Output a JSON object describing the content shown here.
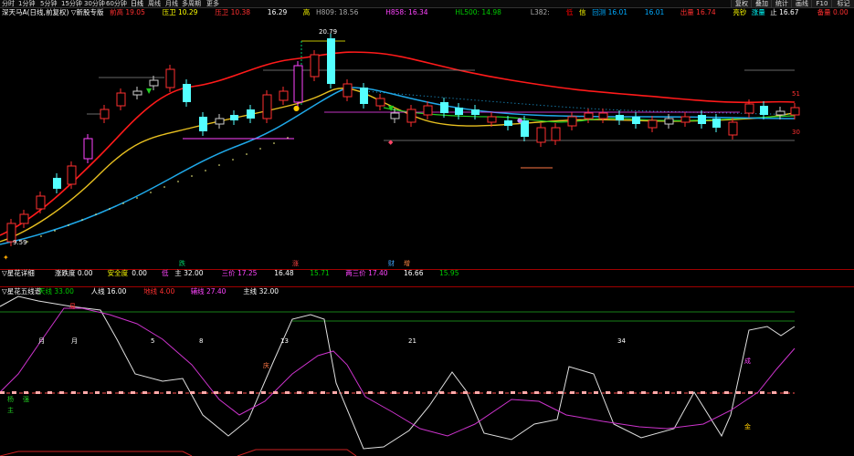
{
  "toolbar": {
    "tabs": [
      "分时",
      "1分钟",
      "5分钟",
      "15分钟",
      "30分钟",
      "60分钟",
      "日线",
      "周线",
      "月线",
      "多周期",
      "更多"
    ],
    "right_buttons": [
      "复权",
      "叠加",
      "统计",
      "画线",
      "F10",
      "标记"
    ]
  },
  "main_info": {
    "title": "深天马A(日线,前复权) ▽新股专版",
    "items": [
      {
        "label": "前高",
        "value": "19.05",
        "color": "#ff3030"
      },
      {
        "label": "压卫",
        "value": "10.29",
        "color": "#ffff00"
      },
      {
        "label": "压卫",
        "value": "10.38",
        "color": "#ff3030"
      },
      {
        "label": "",
        "value": "16.29",
        "color": "#ffffff"
      },
      {
        "label": "高",
        "value": "",
        "color": "#ffff00"
      },
      {
        "label": "H809:",
        "value": "18.56",
        "color": "#aaaaaa"
      },
      {
        "label": "H858:",
        "value": "16.34",
        "color": "#ff44ff"
      },
      {
        "label": "HL500:",
        "value": "14.98",
        "color": "#00cc00"
      },
      {
        "label": "L382:",
        "value": "",
        "color": "#aaaaaa"
      },
      {
        "label": "低",
        "value": "",
        "color": "#ff0000"
      },
      {
        "label": "信",
        "value": "",
        "color": "#ffff00"
      },
      {
        "label": "回测",
        "value": "16.01",
        "color": "#00aaff"
      },
      {
        "label": "",
        "value": "16.01",
        "color": "#00aaff"
      },
      {
        "label": "出量",
        "value": "16.74",
        "color": "#ff3030"
      },
      {
        "label": "亮钞",
        "value": "",
        "color": "#ffff00"
      },
      {
        "label": "涨量",
        "value": "",
        "color": "#00ffff"
      },
      {
        "label": "止",
        "value": "16.67",
        "color": "#ffffff"
      },
      {
        "label": "备量",
        "value": "0.00",
        "color": "#ff3030"
      }
    ],
    "price_labels": {
      "high": "20.79",
      "low": "9.59",
      "right_top": "51",
      "right_bottom": "30"
    },
    "signals": [
      "跌",
      "涨",
      "财",
      "增"
    ]
  },
  "panel2_info": {
    "title": "▽星花详细",
    "items": [
      {
        "text": "涨跌度 0.00",
        "color": "#ffffff"
      },
      {
        "text": "安全度",
        "color": "#ffff00"
      },
      {
        "text": "0.00",
        "color": "#ffffff"
      },
      {
        "text": "低",
        "color": "#ff44ff"
      },
      {
        "text": "主 32.00",
        "color": "#ffffff"
      },
      {
        "text": "三价 17.25",
        "color": "#ff44ff"
      },
      {
        "text": "16.48",
        "color": "#ffffff"
      },
      {
        "text": "15.71",
        "color": "#00cc00"
      },
      {
        "text": "两三价 17.40",
        "color": "#ff44ff"
      },
      {
        "text": "16.66",
        "color": "#ffffff"
      },
      {
        "text": "15.95",
        "color": "#00cc00"
      }
    ]
  },
  "panel3_info": {
    "title": "▽星花五线谱",
    "items": [
      {
        "text": "天线 33.00",
        "color": "#00cc00"
      },
      {
        "text": "人线 16.00",
        "color": "#ffffff"
      },
      {
        "text": "地线 4.00",
        "color": "#ff3030"
      },
      {
        "text": "辅线 27.40",
        "color": "#ff44ff"
      },
      {
        "text": "主线 32.00",
        "color": "#ffffff"
      }
    ],
    "labels": [
      "月",
      "月",
      "5",
      "8",
      "13",
      "21",
      "34",
      "杨",
      "强",
      "主",
      "成",
      "庆",
      "金"
    ]
  }
}
